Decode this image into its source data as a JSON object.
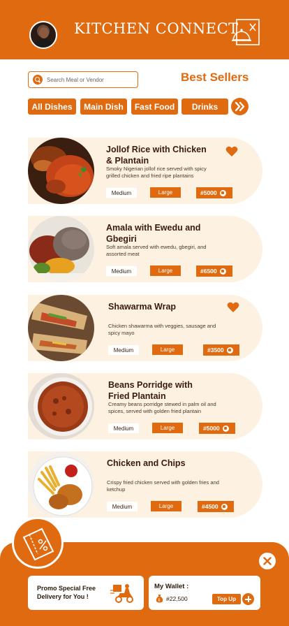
{
  "header": {
    "app_title": "KITCHEN CONNECT",
    "avatar_icon": "user-avatar",
    "logo_icon": "chef-cloche-icon"
  },
  "search": {
    "placeholder": "Search Meal or Vendor"
  },
  "section_title": "Best Sellers",
  "tabs": [
    {
      "label": "All Dishes"
    },
    {
      "label": "Main Dish"
    },
    {
      "label": "Fast Food"
    },
    {
      "label": "Drinks"
    }
  ],
  "items": [
    {
      "name": "Jollof Rice with Chicken & Plantain",
      "description": "Smoky Nigerian jollof rice served with spicy grilled chicken and fried ripe plantains",
      "option_medium": "Medium",
      "option_large": "Large",
      "price": "#5000",
      "favorite": true
    },
    {
      "name": "Amala with Ewedu and Gbegiri",
      "description": "Soft amala served with ewedu, gbegiri, and assorted meat",
      "option_medium": "Medium",
      "option_large": "Large",
      "price": "#6500",
      "favorite": false
    },
    {
      "name": "Shawarma Wrap",
      "description": "Chicken shawarma with veggies, sausage and spicy mayo",
      "option_medium": "Medium",
      "option_large": "Large",
      "price": "#3500",
      "favorite": true
    },
    {
      "name": "Beans Porridge with Fried Plantain",
      "description": "Creamy beans porridge stewed in palm oil and spices, served with golden fried plantain",
      "option_medium": "Medium",
      "option_large": "Large",
      "price": "#5000",
      "favorite": false
    },
    {
      "name": "Chicken and Chips",
      "description": "Crispy fried chicken served with golden fries and ketchup",
      "option_medium": "Medium",
      "option_large": "Large",
      "price": "#4500",
      "favorite": false
    }
  ],
  "bottom": {
    "promo_text": "Promo Special Free Delivery for You !",
    "wallet_title": "My Wallet :",
    "wallet_balance": "#22,500",
    "topup_label": "Top Up"
  },
  "colors": {
    "accent": "#e06a10",
    "card_bg": "#fdf1e2",
    "text_dark": "#3a1a0a"
  }
}
